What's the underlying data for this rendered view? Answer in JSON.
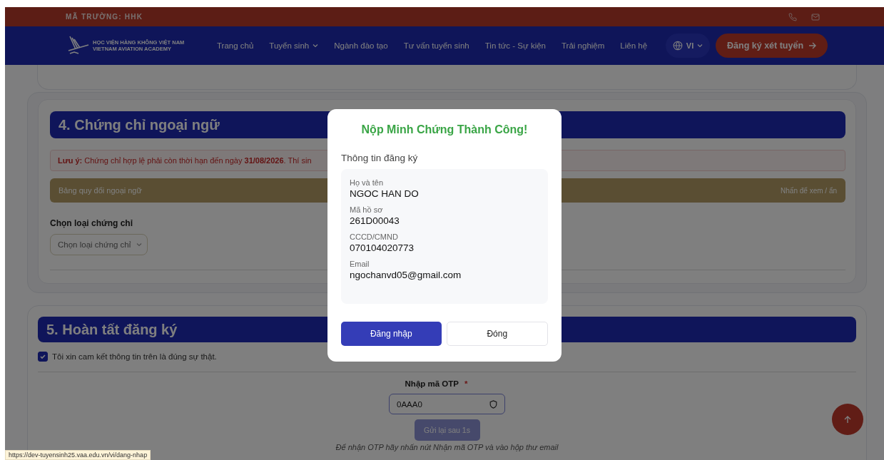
{
  "top_bar": {
    "school_code": "MÃ TRƯỜNG: HHK"
  },
  "nav": {
    "logo_line_1": "HỌC VIỆN HÀNG KHÔNG VIỆT NAM",
    "logo_line_2": "VIETNAM AVIATION ACADEMY",
    "items": [
      {
        "label": "Trang chủ",
        "dropdown": false
      },
      {
        "label": "Tuyển sinh",
        "dropdown": true
      },
      {
        "label": "Ngành đào tạo",
        "dropdown": false
      },
      {
        "label": "Tư vấn tuyển sinh",
        "dropdown": false
      },
      {
        "label": "Tin tức - Sự kiện",
        "dropdown": false
      },
      {
        "label": "Trải nghiệm",
        "dropdown": false
      },
      {
        "label": "Liên hệ",
        "dropdown": false
      }
    ],
    "language": "VI",
    "cta": "Đăng ký xét tuyển"
  },
  "section_4": {
    "title": "4. Chứng chỉ ngoại ngữ",
    "note": "**Lưu ý:** Chứng chỉ hợp lệ phải còn thời hạn đến ngày **31/08/2026**. Thí sin",
    "conversion_table": {
      "label": "Bảng quy đổi ngoại ngữ",
      "hint": "Nhấn để xem / ẩn"
    },
    "field_label": "Chọn loại chứng chỉ",
    "select_placeholder": "Chọn loại chứng chỉ"
  },
  "section_5": {
    "title": "5. Hoàn tất đăng ký",
    "commitment": {
      "label": "Tôi xin cam kết thông tin trên là đúng sự thật.",
      "checked": true
    },
    "otp": {
      "label": "Nhập mã OTP",
      "required_mark": "*",
      "value": "0AAA0"
    },
    "resend_button": {
      "label": "Gửi lại sau 1s",
      "disabled": true
    },
    "hint": "Để nhận OTP hãy nhấn nút Nhận mã OTP và vào hộp thư email"
  },
  "modal": {
    "title": "Nộp Minh Chứng Thành Công!",
    "subtitle": "Thông tin đăng ký",
    "fields": [
      {
        "label": "Họ và tên",
        "value": "NGOC HAN DO"
      },
      {
        "label": "Mã hồ sơ",
        "value": "261D00043"
      },
      {
        "label": "CCCD/CMND",
        "value": "070104020773"
      },
      {
        "label": "Email",
        "value": "ngochanvd05@gmail.com"
      }
    ],
    "buttons": [
      {
        "label": "Đăng nhập",
        "kind": "primary"
      },
      {
        "label": "Đóng",
        "kind": "secondary"
      }
    ]
  },
  "status_url": "https://dev-tuyensinh25.vaa.edu.vn/vi/dang-nhap"
}
